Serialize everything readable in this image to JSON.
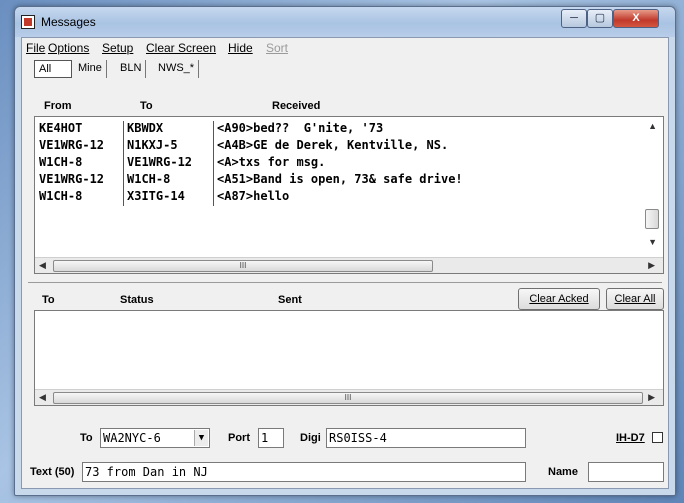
{
  "window": {
    "title": "Messages",
    "minimize": "─",
    "maximize": "▢",
    "close": "X"
  },
  "menu": {
    "file": "File",
    "options": "Options",
    "setup": "Setup",
    "clear_screen": "Clear Screen",
    "hide": "Hide",
    "sort": "Sort"
  },
  "tabs": [
    "All",
    "Mine",
    "BLN",
    "NWS_*"
  ],
  "received": {
    "headers": {
      "from": "From",
      "to": "To",
      "received": "Received"
    },
    "rows": [
      {
        "from": "KE4HOT",
        "to": "KBWDX",
        "msg": "<A90>bed??  G'nite, '73"
      },
      {
        "from": "VE1WRG-12",
        "to": "N1KXJ-5",
        "msg": "<A4B>GE de Derek, Kentville, NS."
      },
      {
        "from": "W1CH-8",
        "to": "VE1WRG-12",
        "msg": "<A>txs for msg."
      },
      {
        "from": "VE1WRG-12",
        "to": "W1CH-8",
        "msg": "<A51>Band is open, 73& safe drive!"
      },
      {
        "from": "W1CH-8",
        "to": "X3ITG-14",
        "msg": "<A87>hello"
      }
    ],
    "scroll_grip": "III"
  },
  "sent": {
    "headers": {
      "to": "To",
      "status": "Status",
      "sent": "Sent"
    },
    "clear_acked": "Clear Acked",
    "clear_all": "Clear All",
    "scroll_grip": "III"
  },
  "compose": {
    "to_label": "To",
    "to_value": "WA2NYC-6",
    "port_label": "Port",
    "port_value": "1",
    "digi_label": "Digi",
    "digi_value": "RS0ISS-4",
    "ihd7_label": "IH-D7",
    "text_label": "Text (50)",
    "text_value": "73 from Dan in NJ",
    "name_label": "Name",
    "name_value": ""
  }
}
